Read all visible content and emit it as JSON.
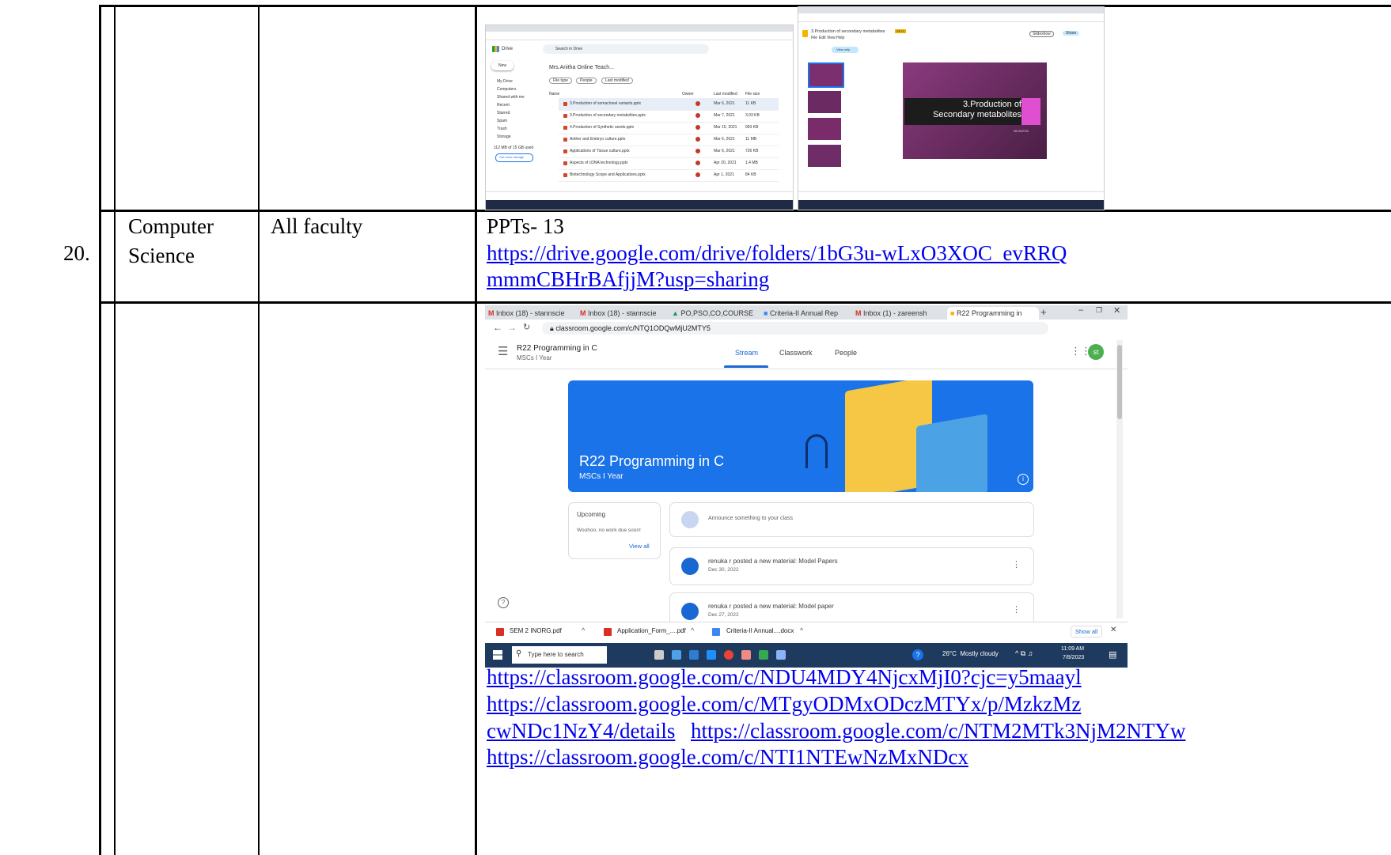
{
  "table": {
    "row_number": "20.",
    "department": "Computer Science",
    "faculty": "All faculty",
    "ppts_label": "PPTs- 13",
    "drive_link": "https://drive.google.com/drive/folders/1bG3u-wLxO3XOC_evRRQmmmCBHrBAfjjM?usp=sharing",
    "drive_link_lines": [
      "https://drive.google.com/drive/folders/1bG3u-wLxO3XOC_evRRQ",
      "mmmCBHrBAfjjM?usp=sharing"
    ],
    "classroom_links": [
      "https://classroom.google.com/c/NDU4MDY4NjcxMjI0?cjc=y5maayl",
      "https://classroom.google.com/c/MTgyODMxODczMTYx/p/MzkzMzcwNDc1NzY4/details",
      "https://classroom.google.com/c/NTM2MTk3NjM2NTYw",
      "https://classroom.google.com/c/NTI1NTEwNzMxNDcx"
    ],
    "classroom_link_lines": {
      "line1": "https://classroom.google.com/c/NDU4MDY4NjcxMjI0?cjc=y5maayl",
      "line2": "https://classroom.google.com/c/MTgyODMxODczMTYx/p/Mzkz​Mz",
      "line3a": "cwNDc1NzY4/details",
      "line3b": "https://classroom.google.com/c/NTM2MTk3NjM2NTYw",
      "line4": "https://classroom.google.com/c/NTI1NTEwNzMxNDcx"
    }
  },
  "drive_screenshot": {
    "app": "Drive",
    "search_placeholder": "Search in Drive",
    "folder_title": "Mrs.Anitha Online Teach...",
    "filters": [
      "File type",
      "People",
      "Last modified"
    ],
    "columns": [
      "Name",
      "Owner",
      "Last modified",
      "File size"
    ],
    "sidebar": [
      "New",
      "My Drive",
      "Computers",
      "Shared with me",
      "Recent",
      "Starred",
      "Spam",
      "Trash",
      "Storage"
    ],
    "storage_text": "112 MB of 15 GB used",
    "storage_button": "Get more storage",
    "files": [
      {
        "name": "3.Production of somaclonal variants.pptx",
        "modified": "Mar 6, 2021",
        "size": "11 KB"
      },
      {
        "name": "3.Production of secondary metabolites.pptx",
        "modified": "Mar 7, 2021",
        "size": "3.03 KB"
      },
      {
        "name": "4.Production of Synthetic seeds.pptx",
        "modified": "Mar 15, 2021",
        "size": "993 KB"
      },
      {
        "name": "Anther and Embryo culture.pptx",
        "modified": "Mar 6, 2021",
        "size": "11 MB"
      },
      {
        "name": "Applications of Tissue culture.pptx",
        "modified": "Mar 6, 2021",
        "size": "726 KB"
      },
      {
        "name": "Aspects of cDNA technology.pptx",
        "modified": "Apr 20, 2021",
        "size": "1.4 MB"
      },
      {
        "name": "Biotechnology Scope and Applications.pptx",
        "modified": "Apr 1, 2021",
        "size": "84 KB"
      }
    ]
  },
  "slides_screenshot": {
    "doc_title": "3.Production of secondary metabolites",
    "badge": "PPTX",
    "menu": [
      "File",
      "Edit",
      "View",
      "Help"
    ],
    "view_only": "View only",
    "slideshow": "Slideshow",
    "share": "Share",
    "slide_title_line1": "3.Production of",
    "slide_title_line2": "Secondary metabolites",
    "slide_author": "MS ANITHA"
  },
  "classroom_screenshot": {
    "tabs": [
      "Inbox (18) - stannscie",
      "Inbox (18) - stannscie",
      "PO,PSO,CO,COURSE",
      "Criteria-II Annual Rep",
      "Inbox (1) - zareensh",
      "R22 Programming in"
    ],
    "url": "classroom.google.com/c/NTQ1ODQwMjU2MTY5",
    "class_name": "R22 Programming in C",
    "class_section": "MSCs I Year",
    "nav": [
      "Stream",
      "Classwork",
      "People"
    ],
    "avatar": "st",
    "banner_title": "R22 Programming in C",
    "banner_subtitle": "MSCs I Year",
    "upcoming_title": "Upcoming",
    "upcoming_text": "Woohoo, no work due soon!",
    "view_all": "View all",
    "announce_placeholder": "Announce something to your class",
    "posts": [
      {
        "text": "renuka r posted a new material: Model Papers",
        "date": "Dec 30, 2022"
      },
      {
        "text": "renuka r posted a new material: Model paper",
        "date": "Dec 27, 2022"
      }
    ],
    "downloads": [
      "SEM 2 INORG.pdf",
      "Application_Form_....pdf",
      "Criteria-II Annual....docx"
    ],
    "show_all": "Show all",
    "taskbar_search": "Type here to search",
    "weather": "26°C  Mostly cloudy",
    "time": "11:09 AM",
    "date": "7/8/2023"
  },
  "colors": {
    "link": "#0000ee",
    "classroom_banner": "#1a73e8",
    "slide_bg": "#7b2f6e",
    "taskbar": "#1f3a5f"
  }
}
